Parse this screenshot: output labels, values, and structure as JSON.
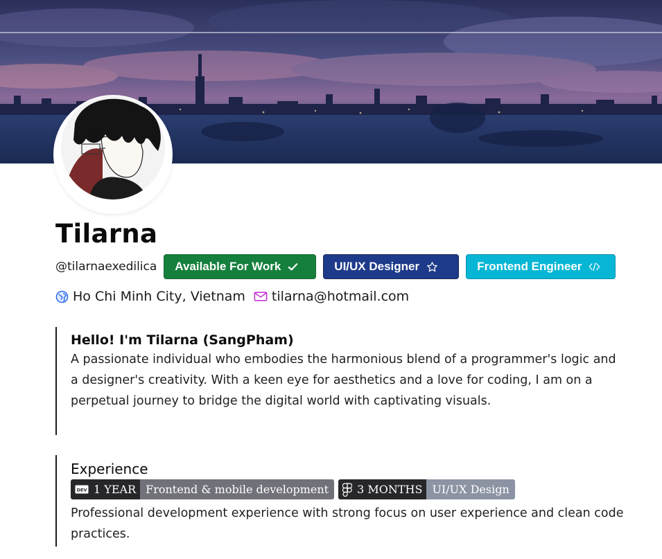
{
  "profile": {
    "name": "Tilarna",
    "handle": "@tilarnaexedilica",
    "badges": [
      {
        "label": "Available For Work",
        "icon": "check-icon",
        "color": "#15803d"
      },
      {
        "label": "UI/UX Designer",
        "icon": "star-icon",
        "color": "#1e3a8a"
      },
      {
        "label": "Frontend Engineer",
        "icon": "code-icon",
        "color": "#06b6d4"
      }
    ],
    "location": "Ho Chi Minh City, Vietnam",
    "email": "tilarna@hotmail.com"
  },
  "intro": {
    "title": "Hello! I'm Tilarna (SangPham)",
    "body": "A passionate individual who embodies the harmonious blend of a programmer's logic and a designer's creativity. With a keen eye for aesthetics and a love for coding, I am on a perpetual journey to bridge the digital world with captivating visuals."
  },
  "experience": {
    "title": "Experience",
    "tags": [
      {
        "duration": "1 YEAR",
        "field": "Frontend & mobile development",
        "icon": "dev-icon"
      },
      {
        "duration": "3 MONTHS",
        "field": "UI/UX Design",
        "icon": "figma-icon"
      }
    ],
    "body": "Professional development experience with strong focus on user experience and clean code practices."
  }
}
